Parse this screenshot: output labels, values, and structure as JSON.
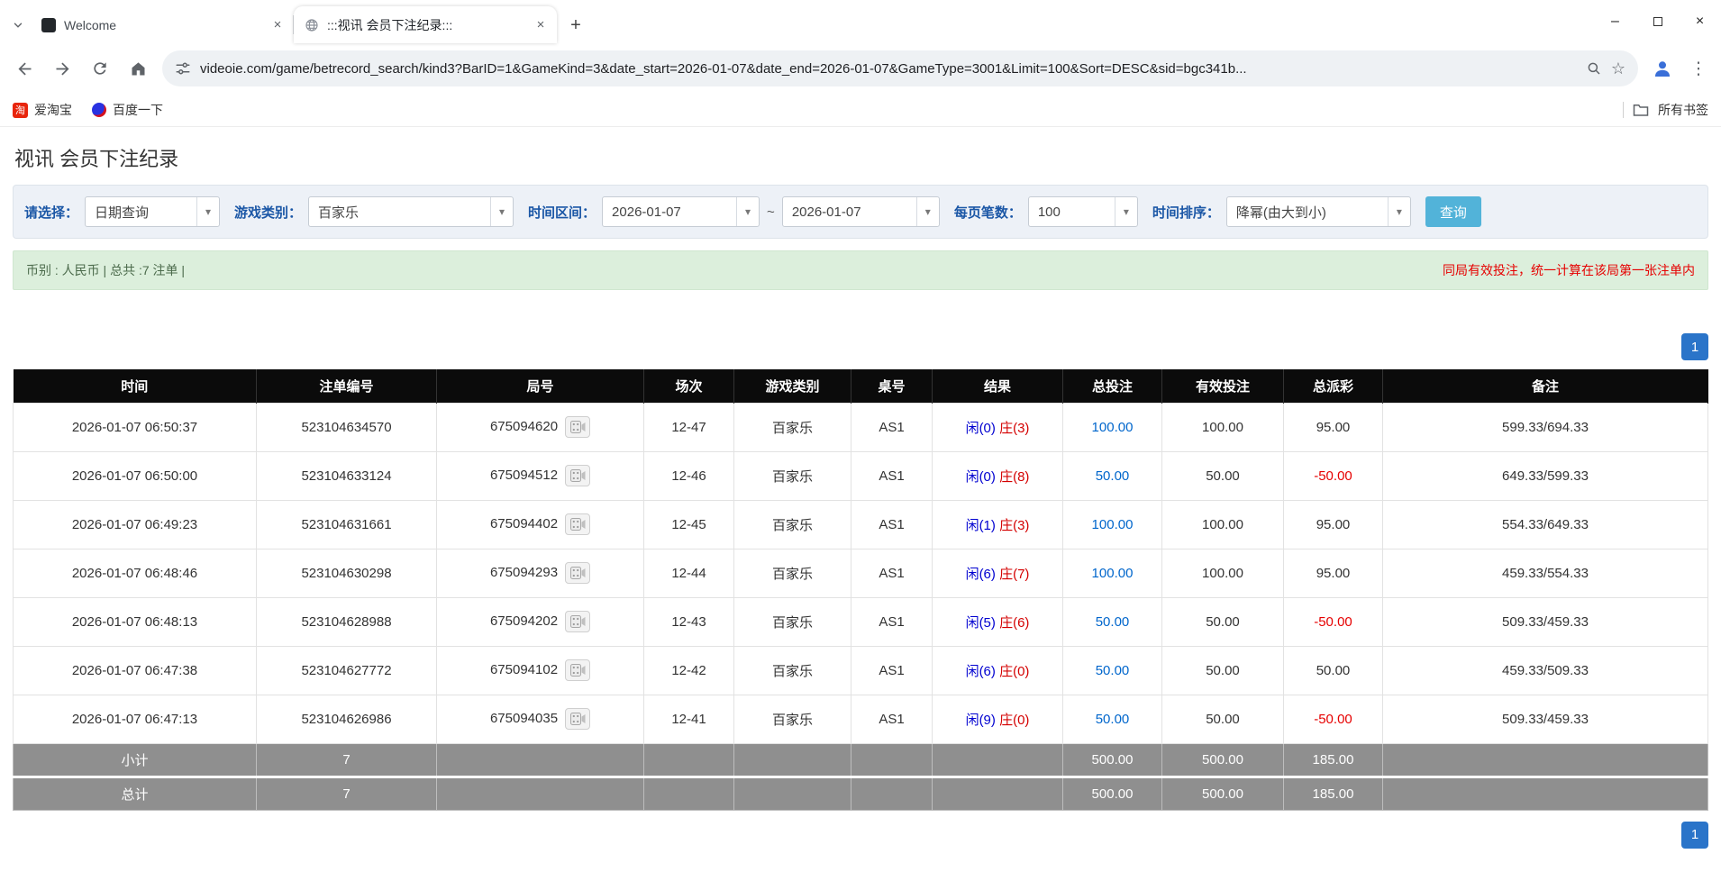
{
  "browser": {
    "tabs": [
      {
        "title": "Welcome"
      },
      {
        "title": ":::视讯 会员下注纪录:::"
      }
    ],
    "url": "videoie.com/game/betrecord_search/kind3?BarID=1&GameKind=3&date_start=2026-01-07&date_end=2026-01-07&GameType=3001&Limit=100&Sort=DESC&sid=bgc341b...",
    "bookmarks": {
      "taobao": "爱淘宝",
      "baidu": "百度一下",
      "all_bookmarks": "所有书签"
    }
  },
  "icons": {
    "tab_close": "×",
    "new_tab": "+",
    "window_close": "×",
    "menu_dots": "⋮",
    "star": "☆",
    "caret_down": "▾",
    "taobao_glyph": "淘"
  },
  "page": {
    "title": "视讯 会员下注纪录",
    "filters": {
      "select_label": "请选择：",
      "select_value": "日期查询",
      "game_type_label": "游戏类别：",
      "game_type_value": "百家乐",
      "date_range_label": "时间区间：",
      "date_start": "2026-01-07",
      "date_separator": "~",
      "date_end": "2026-01-07",
      "page_size_label": "每页笔数：",
      "page_size_value": "100",
      "sort_label": "时间排序：",
      "sort_value": "降幂(由大到小)",
      "search_button": "查询"
    },
    "info_bar": {
      "summary": "币别 : 人民币 | 总共 :7 注单 |",
      "notice": "同局有效投注，统一计算在该局第一张注单内"
    },
    "pagination": {
      "page": "1"
    },
    "table": {
      "headers": [
        "时间",
        "注单编号",
        "局号",
        "场次",
        "游戏类别",
        "桌号",
        "结果",
        "总投注",
        "有效投注",
        "总派彩",
        "备注"
      ],
      "rows": [
        {
          "time": "2026-01-07 06:50:37",
          "bet_id": "523104634570",
          "round": "675094620",
          "session": "12-47",
          "game": "百家乐",
          "table_no": "AS1",
          "result_player": "闲(0)",
          "result_banker": "庄(3)",
          "total_bet": "100.00",
          "valid_bet": "100.00",
          "payout": "95.00",
          "note": "599.33/694.33"
        },
        {
          "time": "2026-01-07 06:50:00",
          "bet_id": "523104633124",
          "round": "675094512",
          "session": "12-46",
          "game": "百家乐",
          "table_no": "AS1",
          "result_player": "闲(0)",
          "result_banker": "庄(8)",
          "total_bet": "50.00",
          "valid_bet": "50.00",
          "payout": "-50.00",
          "note": "649.33/599.33"
        },
        {
          "time": "2026-01-07 06:49:23",
          "bet_id": "523104631661",
          "round": "675094402",
          "session": "12-45",
          "game": "百家乐",
          "table_no": "AS1",
          "result_player": "闲(1)",
          "result_banker": "庄(3)",
          "total_bet": "100.00",
          "valid_bet": "100.00",
          "payout": "95.00",
          "note": "554.33/649.33"
        },
        {
          "time": "2026-01-07 06:48:46",
          "bet_id": "523104630298",
          "round": "675094293",
          "session": "12-44",
          "game": "百家乐",
          "table_no": "AS1",
          "result_player": "闲(6)",
          "result_banker": "庄(7)",
          "total_bet": "100.00",
          "valid_bet": "100.00",
          "payout": "95.00",
          "note": "459.33/554.33"
        },
        {
          "time": "2026-01-07 06:48:13",
          "bet_id": "523104628988",
          "round": "675094202",
          "session": "12-43",
          "game": "百家乐",
          "table_no": "AS1",
          "result_player": "闲(5)",
          "result_banker": "庄(6)",
          "total_bet": "50.00",
          "valid_bet": "50.00",
          "payout": "-50.00",
          "note": "509.33/459.33"
        },
        {
          "time": "2026-01-07 06:47:38",
          "bet_id": "523104627772",
          "round": "675094102",
          "session": "12-42",
          "game": "百家乐",
          "table_no": "AS1",
          "result_player": "闲(6)",
          "result_banker": "庄(0)",
          "total_bet": "50.00",
          "valid_bet": "50.00",
          "payout": "50.00",
          "note": "459.33/509.33"
        },
        {
          "time": "2026-01-07 06:47:13",
          "bet_id": "523104626986",
          "round": "675094035",
          "session": "12-41",
          "game": "百家乐",
          "table_no": "AS1",
          "result_player": "闲(9)",
          "result_banker": "庄(0)",
          "total_bet": "50.00",
          "valid_bet": "50.00",
          "payout": "-50.00",
          "note": "509.33/459.33"
        }
      ],
      "subtotal": {
        "label": "小计",
        "count": "7",
        "total_bet": "500.00",
        "valid_bet": "500.00",
        "payout": "185.00"
      },
      "total": {
        "label": "总计",
        "count": "7",
        "total_bet": "500.00",
        "valid_bet": "500.00",
        "payout": "185.00"
      }
    }
  }
}
